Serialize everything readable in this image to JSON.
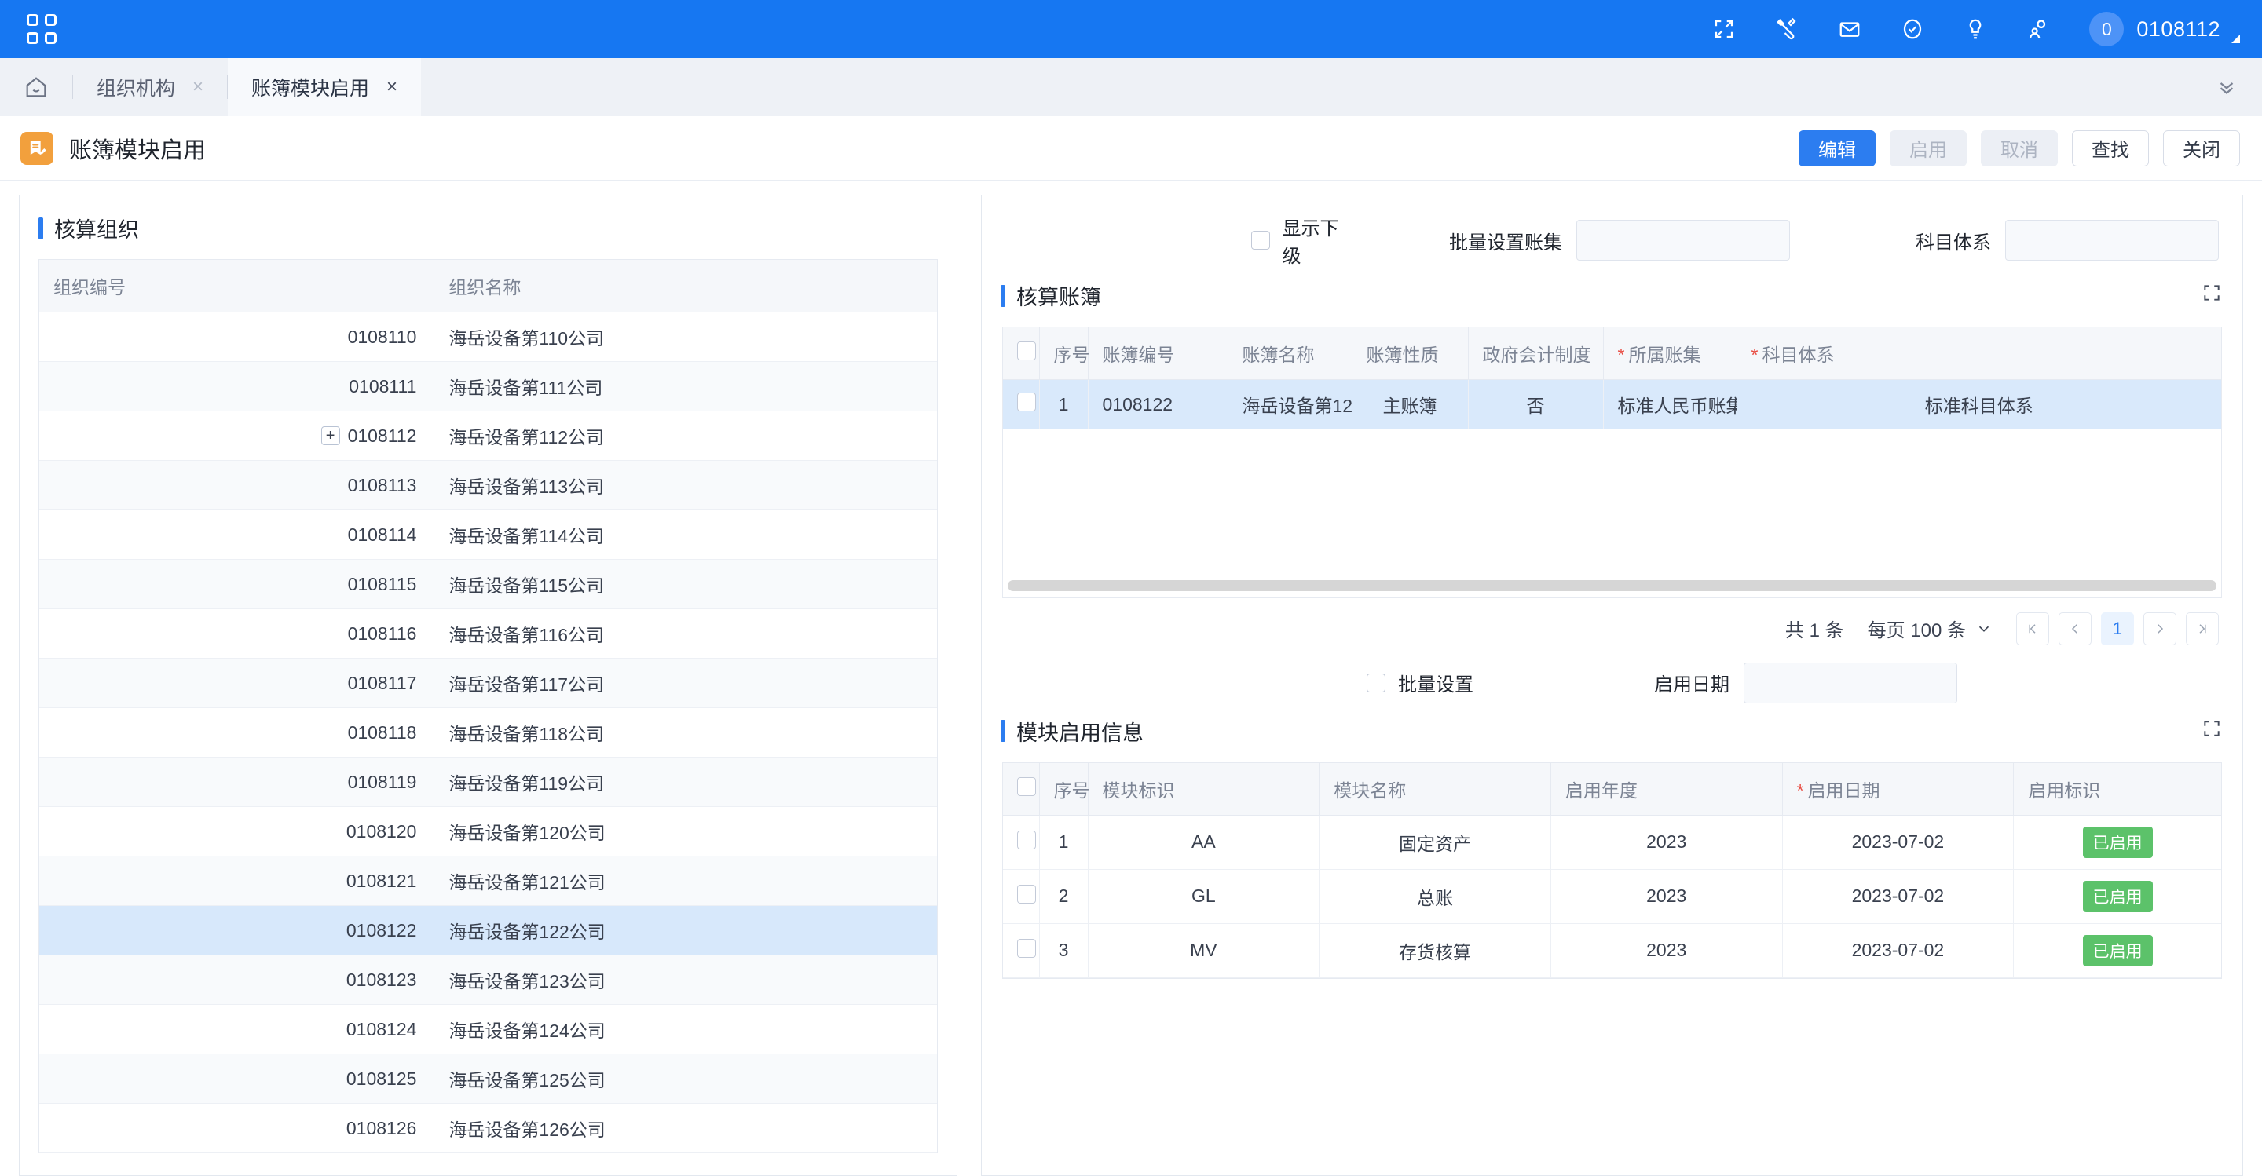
{
  "topbar": {
    "apps_icon": "apps-grid-icon",
    "icons": [
      {
        "name": "fullscreen-icon"
      },
      {
        "name": "tools-icon"
      },
      {
        "name": "mail-icon"
      },
      {
        "name": "check-circle-icon"
      },
      {
        "name": "lightbulb-icon"
      },
      {
        "name": "user-search-icon"
      }
    ],
    "user_badge": "0",
    "user_name": "0108112"
  },
  "tabs": {
    "home_icon": "home-icon",
    "items": [
      {
        "label": "组织机构",
        "active": false,
        "close": "×"
      },
      {
        "label": "账簿模块启用",
        "active": true,
        "close": "×"
      }
    ],
    "collapse_icon": "chevron-double-down-icon"
  },
  "page": {
    "icon": "ledger-edit-icon",
    "title": "账簿模块启用",
    "buttons": [
      {
        "label": "编辑",
        "style": "primary"
      },
      {
        "label": "启用",
        "style": "disabled"
      },
      {
        "label": "取消",
        "style": "disabled"
      },
      {
        "label": "查找",
        "style": "default"
      },
      {
        "label": "关闭",
        "style": "default"
      }
    ]
  },
  "org_panel": {
    "title": "核算组织",
    "columns": [
      "组织编号",
      "组织名称"
    ],
    "rows": [
      {
        "code": "0108110",
        "name": "海岳设备第110公司",
        "expandable": false,
        "selected": false
      },
      {
        "code": "0108111",
        "name": "海岳设备第111公司",
        "expandable": false,
        "selected": false
      },
      {
        "code": "0108112",
        "name": "海岳设备第112公司",
        "expandable": true,
        "selected": false
      },
      {
        "code": "0108113",
        "name": "海岳设备第113公司",
        "expandable": false,
        "selected": false
      },
      {
        "code": "0108114",
        "name": "海岳设备第114公司",
        "expandable": false,
        "selected": false
      },
      {
        "code": "0108115",
        "name": "海岳设备第115公司",
        "expandable": false,
        "selected": false
      },
      {
        "code": "0108116",
        "name": "海岳设备第116公司",
        "expandable": false,
        "selected": false
      },
      {
        "code": "0108117",
        "name": "海岳设备第117公司",
        "expandable": false,
        "selected": false
      },
      {
        "code": "0108118",
        "name": "海岳设备第118公司",
        "expandable": false,
        "selected": false
      },
      {
        "code": "0108119",
        "name": "海岳设备第119公司",
        "expandable": false,
        "selected": false
      },
      {
        "code": "0108120",
        "name": "海岳设备第120公司",
        "expandable": false,
        "selected": false
      },
      {
        "code": "0108121",
        "name": "海岳设备第121公司",
        "expandable": false,
        "selected": false
      },
      {
        "code": "0108122",
        "name": "海岳设备第122公司",
        "expandable": false,
        "selected": true
      },
      {
        "code": "0108123",
        "name": "海岳设备第123公司",
        "expandable": false,
        "selected": false
      },
      {
        "code": "0108124",
        "name": "海岳设备第124公司",
        "expandable": false,
        "selected": false
      },
      {
        "code": "0108125",
        "name": "海岳设备第125公司",
        "expandable": false,
        "selected": false
      },
      {
        "code": "0108126",
        "name": "海岳设备第126公司",
        "expandable": false,
        "selected": false
      }
    ],
    "expander_symbol": "+"
  },
  "ledger_filter": {
    "show_children_label": "显示下级",
    "show_children_checked": false,
    "batch_set_ledgerset_label": "批量设置账集",
    "batch_set_ledgerset_value": "",
    "subject_system_label": "科目体系",
    "subject_system_value": ""
  },
  "ledger_panel": {
    "title": "核算账簿",
    "expand_icon": "expand-corners-icon",
    "columns": [
      {
        "label": "",
        "type": "checkbox"
      },
      {
        "label": "序号"
      },
      {
        "label": "账簿编号"
      },
      {
        "label": "账簿名称"
      },
      {
        "label": "账簿性质"
      },
      {
        "label": "政府会计制度"
      },
      {
        "label": "所属账集",
        "required": true
      },
      {
        "label": "科目体系",
        "required": true
      }
    ],
    "rows": [
      {
        "seq": "1",
        "code": "0108122",
        "name": "海岳设备第12...",
        "nature": "主账簿",
        "gov_system": "否",
        "ledger_set": "标准人民币账集",
        "subject_system": "标准科目体系",
        "selected": true,
        "checked": false
      }
    ],
    "pager": {
      "total": "共 1 条",
      "page_size": "每页 100 条",
      "page_size_caret": "⌄",
      "first": "⟨|",
      "prev": "‹",
      "current": "1",
      "next": "›",
      "last": "|⟩"
    }
  },
  "module_filter": {
    "batch_set_label": "批量设置",
    "batch_set_checked": false,
    "enable_date_label": "启用日期",
    "enable_date_value": ""
  },
  "module_panel": {
    "title": "模块启用信息",
    "expand_icon": "expand-corners-icon",
    "columns": [
      {
        "label": "",
        "type": "checkbox"
      },
      {
        "label": "序号"
      },
      {
        "label": "模块标识"
      },
      {
        "label": "模块名称"
      },
      {
        "label": "启用年度"
      },
      {
        "label": "启用日期",
        "required": true
      },
      {
        "label": "启用标识"
      }
    ],
    "rows": [
      {
        "seq": "1",
        "module_id": "AA",
        "module_name": "固定资产",
        "year": "2023",
        "date": "2023-07-02",
        "status": "已启用",
        "checked": false
      },
      {
        "seq": "2",
        "module_id": "GL",
        "module_name": "总账",
        "year": "2023",
        "date": "2023-07-02",
        "status": "已启用",
        "checked": false
      },
      {
        "seq": "3",
        "module_id": "MV",
        "module_name": "存货核算",
        "year": "2023",
        "date": "2023-07-02",
        "status": "已启用",
        "checked": false
      }
    ]
  },
  "colors": {
    "brand_blue": "#1677f2",
    "primary_button": "#2c7df0",
    "status_green": "#5cc26a",
    "required_red": "#e8493f",
    "selected_row": "#d7e8fb",
    "page_icon_orange": "#f2a03d"
  }
}
